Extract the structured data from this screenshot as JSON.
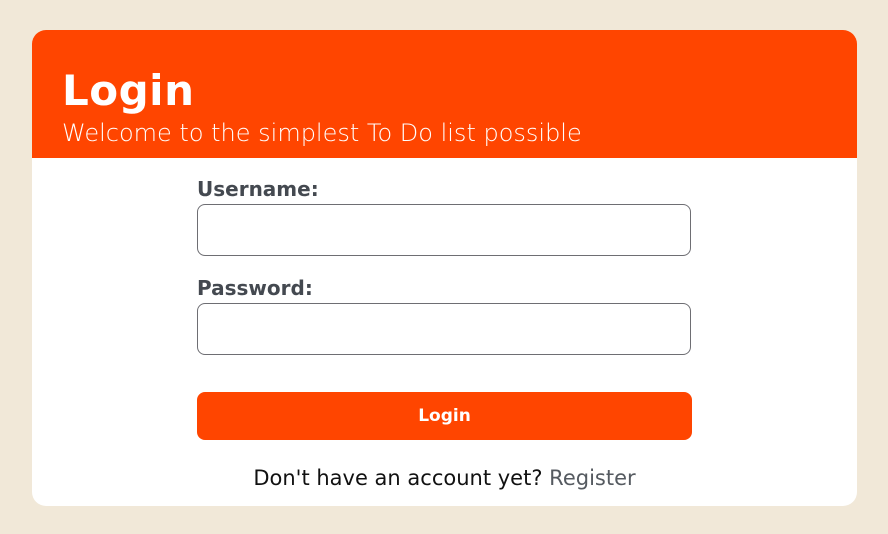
{
  "header": {
    "title": "Login",
    "subtitle": "Welcome to the simplest To Do list possible"
  },
  "form": {
    "username_label": "Username:",
    "username_value": "",
    "password_label": "Password:",
    "password_value": "",
    "submit_label": "Login"
  },
  "footer": {
    "prompt": "Don't have an account yet?",
    "register_label": "Register"
  },
  "colors": {
    "page_background": "#f1e8d8",
    "accent": "#ff4500",
    "card_background": "#ffffff",
    "label_text": "#444950"
  }
}
